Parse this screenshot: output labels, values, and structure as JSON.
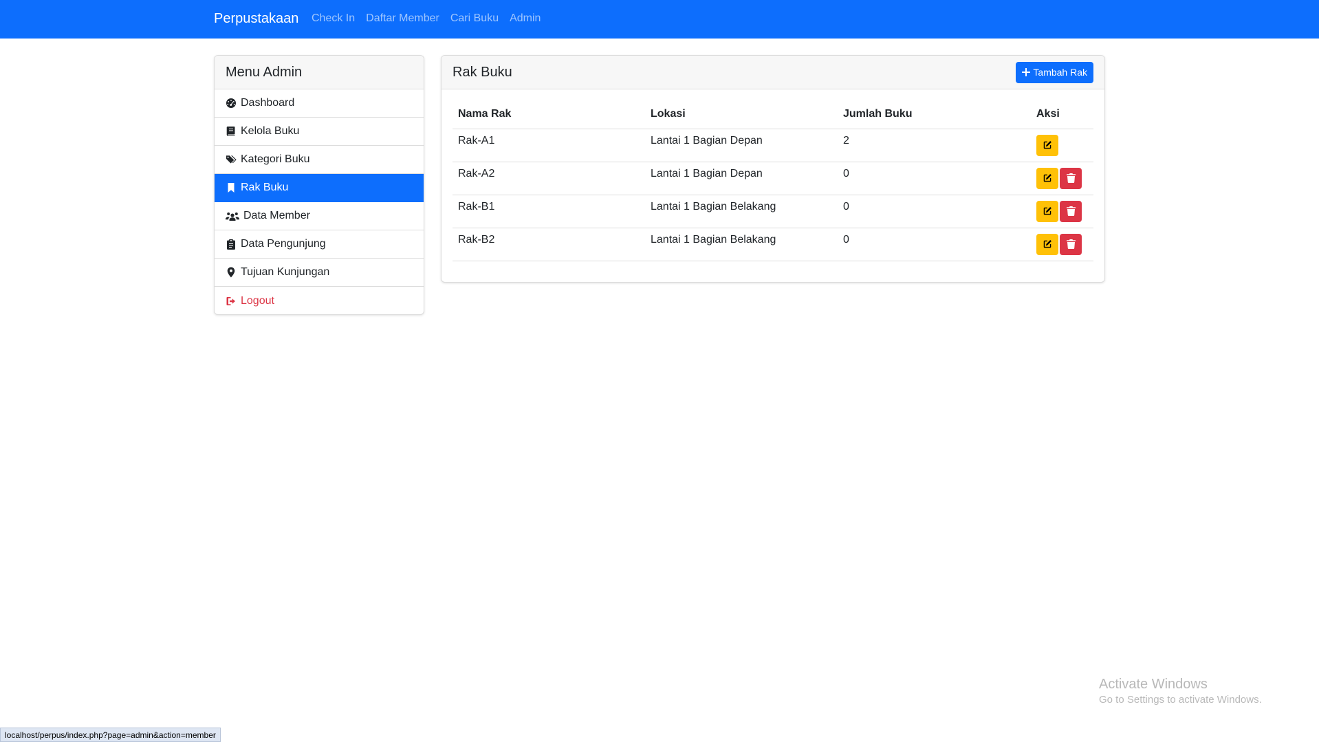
{
  "navbar": {
    "brand": "Perpustakaan",
    "links": [
      "Check In",
      "Daftar Member",
      "Cari Buku",
      "Admin"
    ],
    "color": "#0d6efd"
  },
  "sidebar": {
    "title": "Menu Admin",
    "items": [
      {
        "label": "Dashboard",
        "icon": "gauge-icon"
      },
      {
        "label": "Kelola Buku",
        "icon": "book-icon"
      },
      {
        "label": "Kategori Buku",
        "icon": "tags-icon"
      },
      {
        "label": "Rak Buku",
        "icon": "bookmark-icon",
        "active": true
      },
      {
        "label": "Data Member",
        "icon": "users-icon"
      },
      {
        "label": "Data Pengunjung",
        "icon": "clipboard-icon"
      },
      {
        "label": "Tujuan Kunjungan",
        "icon": "map-marker-icon"
      },
      {
        "label": "Logout",
        "icon": "sign-out-icon",
        "color": "#dc3545"
      }
    ]
  },
  "main": {
    "title": "Rak Buku",
    "add_button": "Tambah Rak",
    "table": {
      "headers": [
        "Nama Rak",
        "Lokasi",
        "Jumlah Buku",
        "Aksi"
      ],
      "rows": [
        {
          "nama": "Rak-A1",
          "lokasi": "Lantai 1 Bagian Depan",
          "jumlah": "2",
          "deletable": false
        },
        {
          "nama": "Rak-A2",
          "lokasi": "Lantai 1 Bagian Depan",
          "jumlah": "0",
          "deletable": true
        },
        {
          "nama": "Rak-B1",
          "lokasi": "Lantai 1 Bagian Belakang",
          "jumlah": "0",
          "deletable": true
        },
        {
          "nama": "Rak-B2",
          "lokasi": "Lantai 1 Bagian Belakang",
          "jumlah": "0",
          "deletable": true
        }
      ]
    }
  },
  "watermark": {
    "title": "Activate Windows",
    "subtitle": "Go to Settings to activate Windows."
  },
  "statusbar": {
    "url": "localhost/perpus/index.php?page=admin&action=member"
  },
  "colors": {
    "primary": "#0d6efd",
    "warning": "#ffc107",
    "danger": "#dc3545"
  }
}
